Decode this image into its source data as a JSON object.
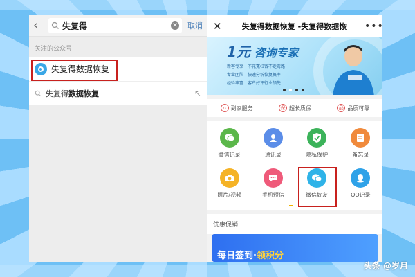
{
  "left": {
    "search_value": "失复得",
    "cancel": "取消",
    "section_label": "关注的公众号",
    "result_name": "失复得数据恢复",
    "suggest_prefix": "失复得",
    "suggest_suffix": "数据恢复"
  },
  "right": {
    "title": "失复得数据恢复 -失复得数据恢",
    "banner": {
      "price": "1元",
      "headline": "咨询专家",
      "bullets": [
        "新客专享",
        "不花冤枉钱不走弯路",
        "专业团队",
        "快速分析恢复概率",
        "经验丰富",
        "客户好评行业领先"
      ]
    },
    "guarantees": [
      "到家服务",
      "超长质保",
      "品质可靠"
    ],
    "grid": [
      {
        "label": "微信记录",
        "icon": "chat-icon",
        "color": "#5bb74a"
      },
      {
        "label": "通讯录",
        "icon": "contacts-icon",
        "color": "#5b8de8"
      },
      {
        "label": "隐私保护",
        "icon": "shield-icon",
        "color": "#3cb35a"
      },
      {
        "label": "备忘录",
        "icon": "memo-icon",
        "color": "#f08a3c"
      },
      {
        "label": "照片/视频",
        "icon": "camera-icon",
        "color": "#f5b326"
      },
      {
        "label": "手机短信",
        "icon": "sms-icon",
        "color": "#ef5a7a"
      },
      {
        "label": "微信好友",
        "icon": "wechat-friends-icon",
        "color": "#2fb3e8"
      },
      {
        "label": "QQ记录",
        "icon": "qq-icon",
        "color": "#2fa2e8"
      }
    ],
    "promo_title": "优惠促销",
    "promo_text_a": "每日签到·",
    "promo_text_b": "领积分"
  },
  "watermark": "头条 @岁月"
}
